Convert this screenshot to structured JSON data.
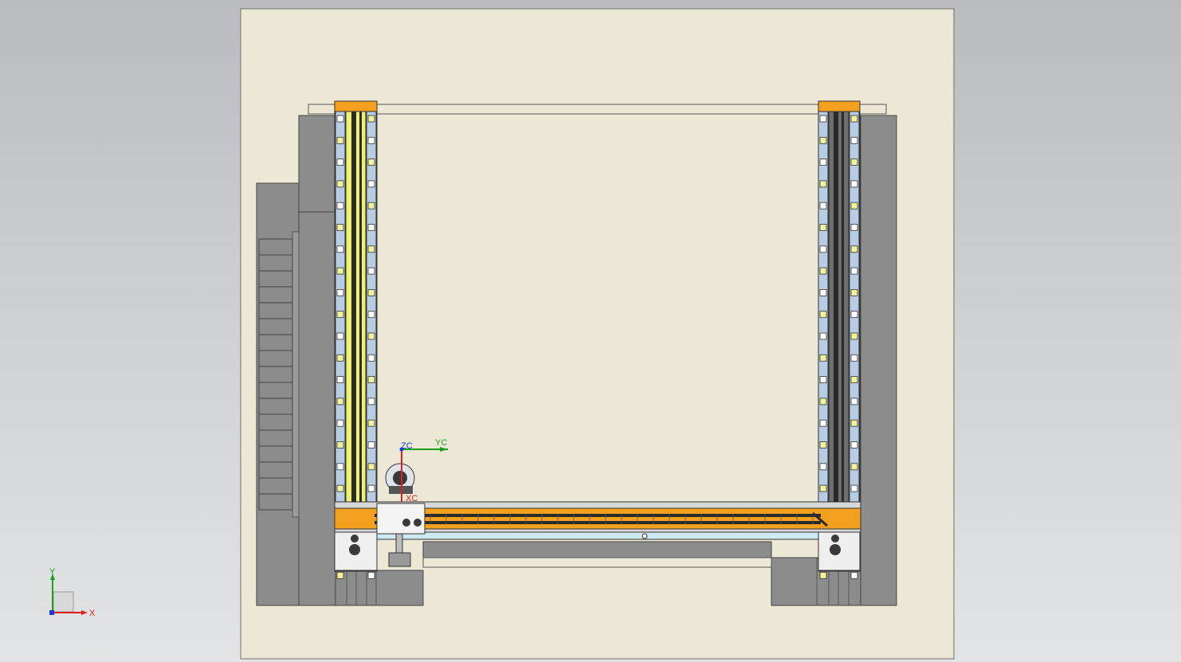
{
  "viewport": {
    "background_top": "#b9bbbe",
    "background_bottom": "#e3e4e5"
  },
  "drawing": {
    "sheet_color": "#ece8d5",
    "sheet_border": "#6e6e6e",
    "concrete_color": "#8c8c8c",
    "steel_blue": "#b8cde3",
    "rail_yellow": "#eef070",
    "beam_orange": "#f3a01e",
    "beam_dark": "#2a2a2a",
    "side_column_pad_count": 22,
    "stair_step_count": 17
  },
  "wcs_triad": {
    "x_label": "X",
    "y_label": "Y",
    "x_color": "#e02020",
    "y_color": "#1ca01c",
    "z_color": "#1a3adf"
  },
  "work_csys": {
    "zc_label": "ZC",
    "yc_label": "YC",
    "xc_label": "XC",
    "zc_color": "#1a3adf",
    "yc_color": "#1ca01c",
    "xc_color": "#e02020"
  }
}
